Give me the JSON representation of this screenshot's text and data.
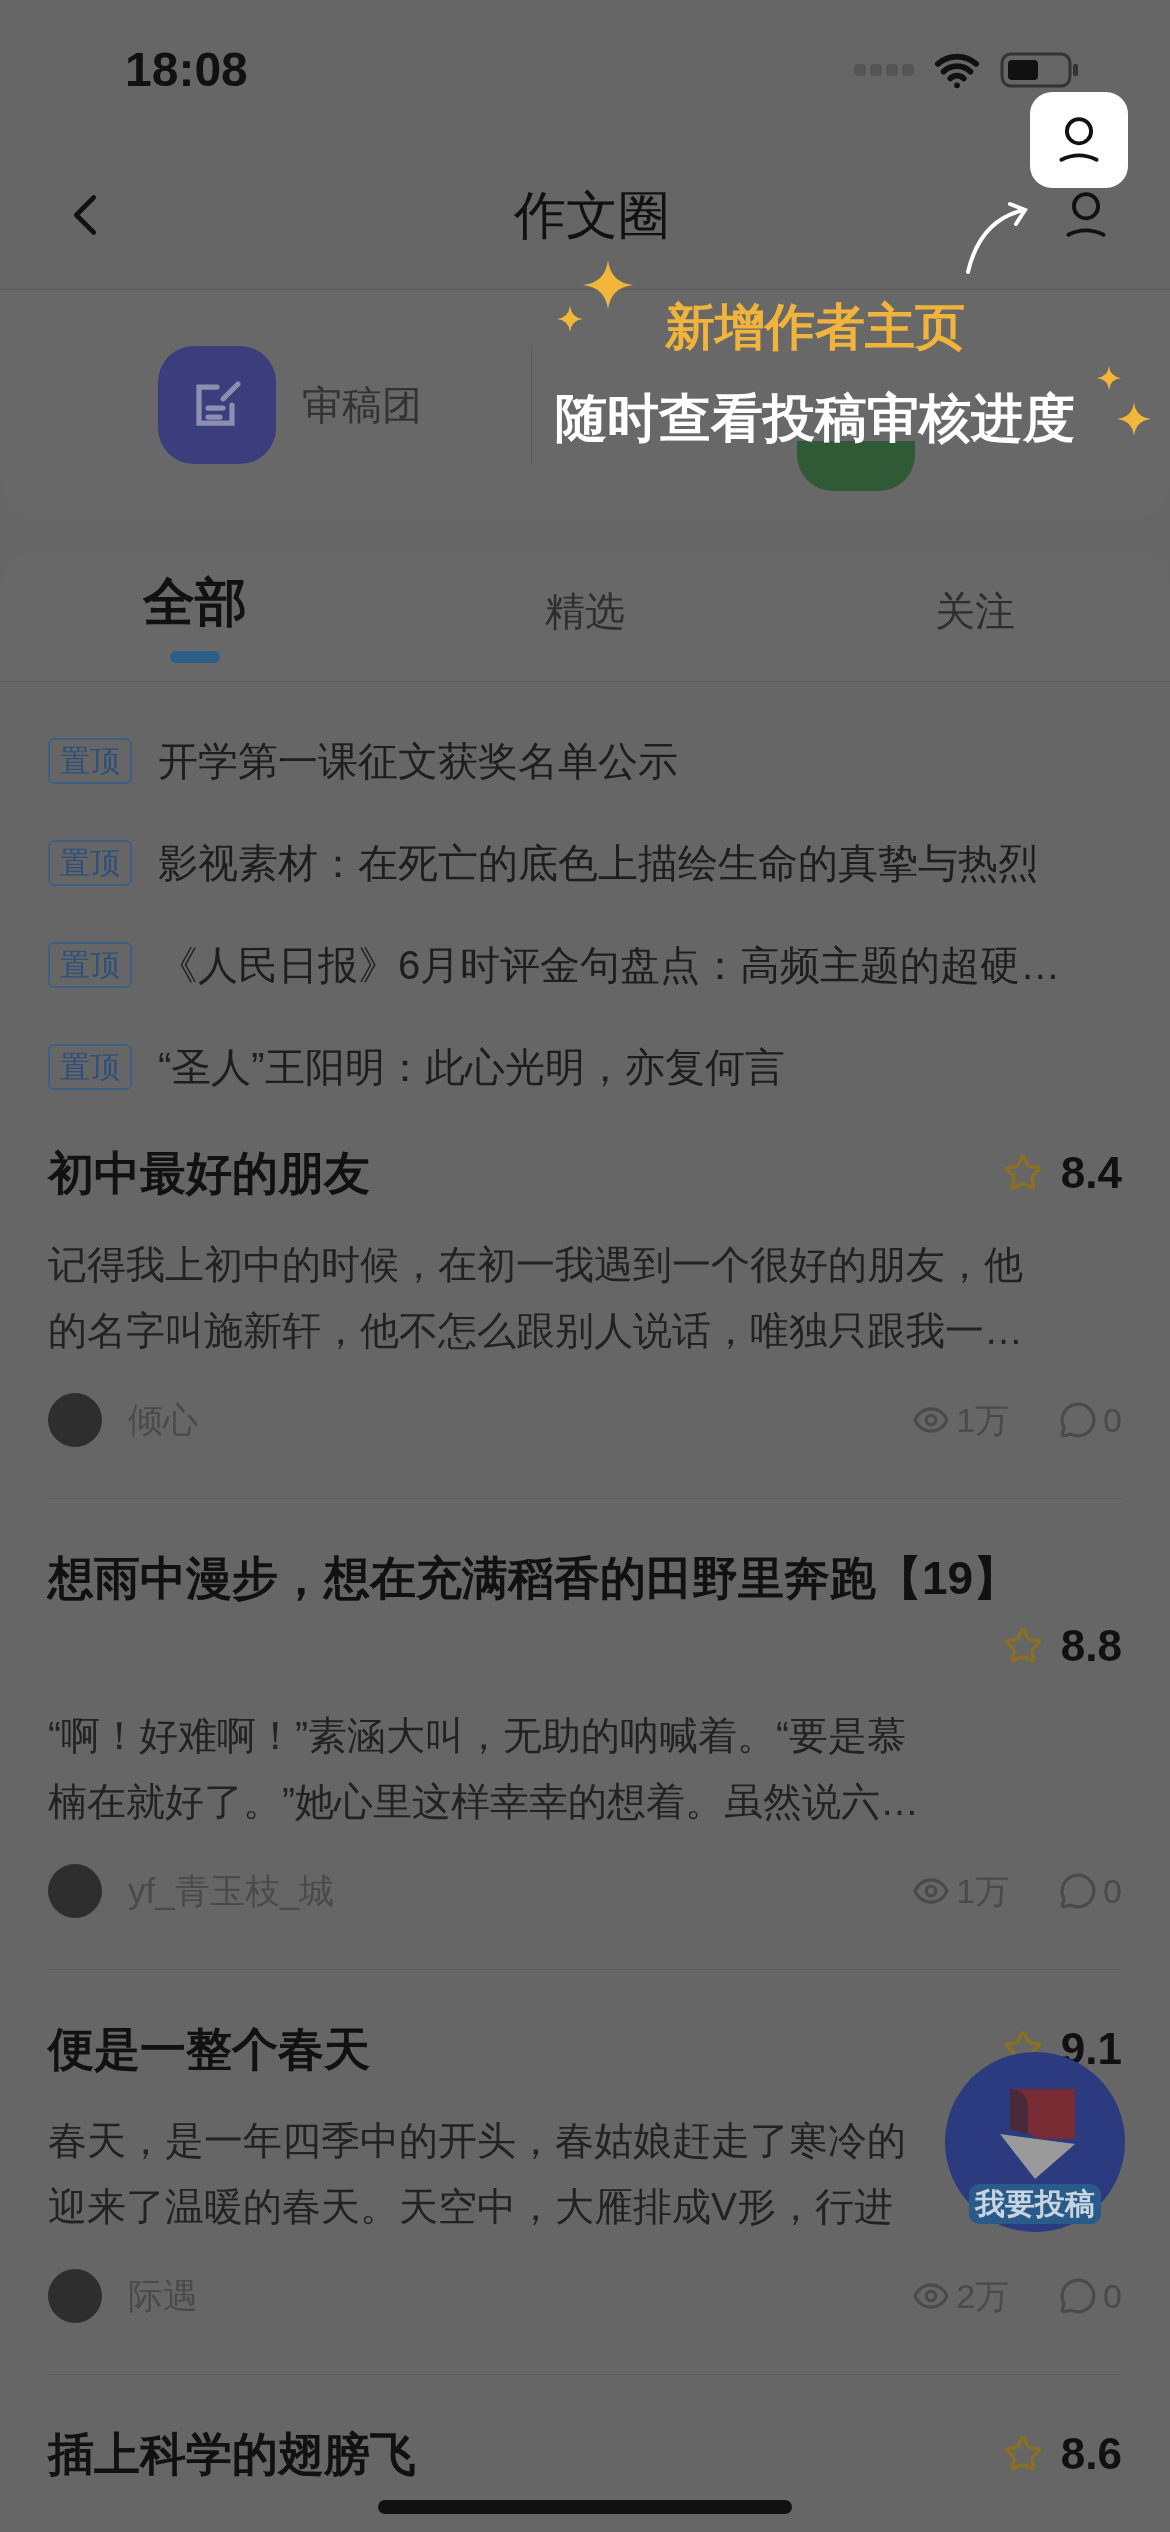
{
  "status_bar": {
    "time": "18:08"
  },
  "nav": {
    "title": "作文圈"
  },
  "coach_mark": {
    "headline": "新增作者主页",
    "subtitle": "随时查看投稿审核进度"
  },
  "quick_entries": [
    {
      "kind": "review",
      "label": "审稿团"
    },
    {
      "kind": "green"
    }
  ],
  "tabs": [
    {
      "label": "全部",
      "selected": true
    },
    {
      "label": "精选",
      "selected": false
    },
    {
      "label": "关注",
      "selected": false
    }
  ],
  "pinned": [
    {
      "tag": "置顶",
      "title": "开学第一课征文获奖名单公示"
    },
    {
      "tag": "置顶",
      "title": "影视素材：在死亡的底色上描绘生命的真挚与热烈"
    },
    {
      "tag": "置顶",
      "title": "《人民日报》6月时评金句盘点：高频主题的超硬…"
    },
    {
      "tag": "置顶",
      "title": "“圣人”王阳明：此心光明，亦复何言"
    }
  ],
  "posts": [
    {
      "title": "初中最好的朋友",
      "rating": "8.4",
      "excerpt_lines": [
        "记得我上初中的时候，在初一我遇到一个很好的朋友，他",
        "的名字叫施新轩，他不怎么跟别人说话，唯独只跟我一…"
      ],
      "author": "倾心",
      "views": "1万",
      "comments": "0"
    },
    {
      "title": "想雨中漫步，想在充满稻香的田野里奔跑【19】",
      "rating": "8.8",
      "excerpt_lines": [
        "“啊！好难啊！”素涵大叫，无助的呐喊着。“要是慕",
        "楠在就好了。”她心里这样幸幸的想着。虽然说六…"
      ],
      "author": "yf_青玉枝_城",
      "views": "1万",
      "comments": "0"
    },
    {
      "title": "便是一整个春天",
      "rating": "9.1",
      "excerpt_lines": [
        "春天，是一年四季中的开头，春姑娘赶走了寒冷的",
        "迎来了温暖的春天。天空中，大雁排成V形，行进"
      ],
      "author": "际遇",
      "views": "2万",
      "comments": "0"
    },
    {
      "title": "插上科学的翅膀飞",
      "rating": "8.6"
    }
  ],
  "fab": {
    "label": "我要投稿"
  }
}
